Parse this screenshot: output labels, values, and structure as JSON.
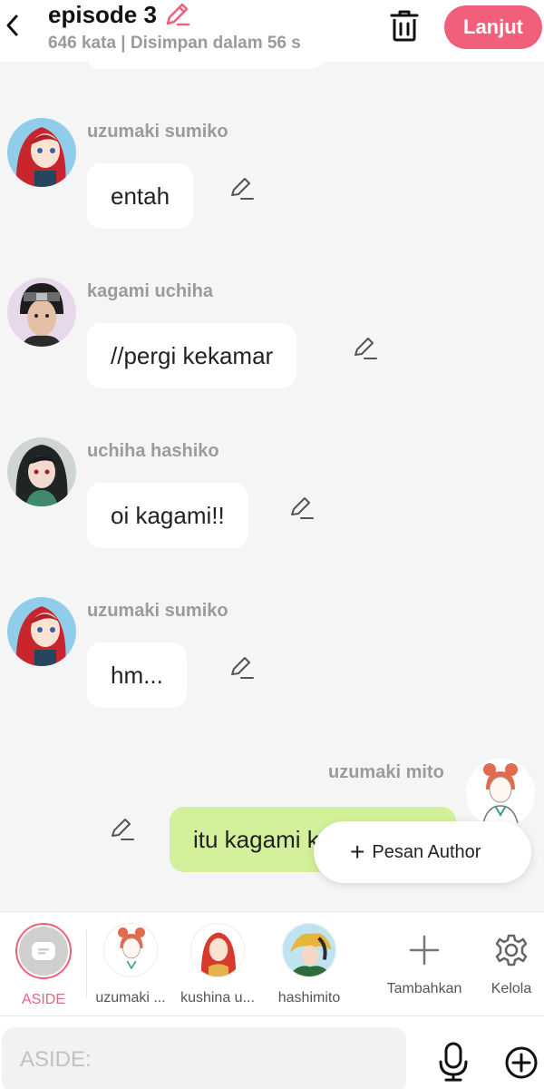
{
  "header": {
    "title": "episode 3",
    "subtitle": "646 kata | Disimpan dalam 56 s",
    "next_label": "Lanjut"
  },
  "messages": [
    {
      "sender": "uzumaki sumiko",
      "text": "entah",
      "side": "left",
      "avatar": "red-hair-girl"
    },
    {
      "sender": "kagami uchiha",
      "text": "//pergi kekamar",
      "side": "left",
      "avatar": "headband-boy"
    },
    {
      "sender": "uchiha hashiko",
      "text": "oi kagami!!",
      "side": "left",
      "avatar": "dark-hair-girl"
    },
    {
      "sender": "uzumaki sumiko",
      "text": "hm...",
      "side": "left",
      "avatar": "red-hair-girl"
    },
    {
      "sender": "uzumaki mito",
      "text": "itu kagami k",
      "side": "right",
      "avatar": "bun-hair-woman"
    }
  ],
  "floating": {
    "label": "Pesan Author"
  },
  "characters": [
    {
      "label": "ASIDE",
      "active": true
    },
    {
      "label": "uzumaki ..."
    },
    {
      "label": "kushina u..."
    },
    {
      "label": "hashimito"
    },
    {
      "label": "Tambahkan"
    },
    {
      "label": "Kelola"
    }
  ],
  "input": {
    "placeholder": "ASIDE:"
  },
  "colors": {
    "accent": "#f25f7a",
    "my_bubble": "#d3f19b",
    "background": "#f5f5f5"
  }
}
